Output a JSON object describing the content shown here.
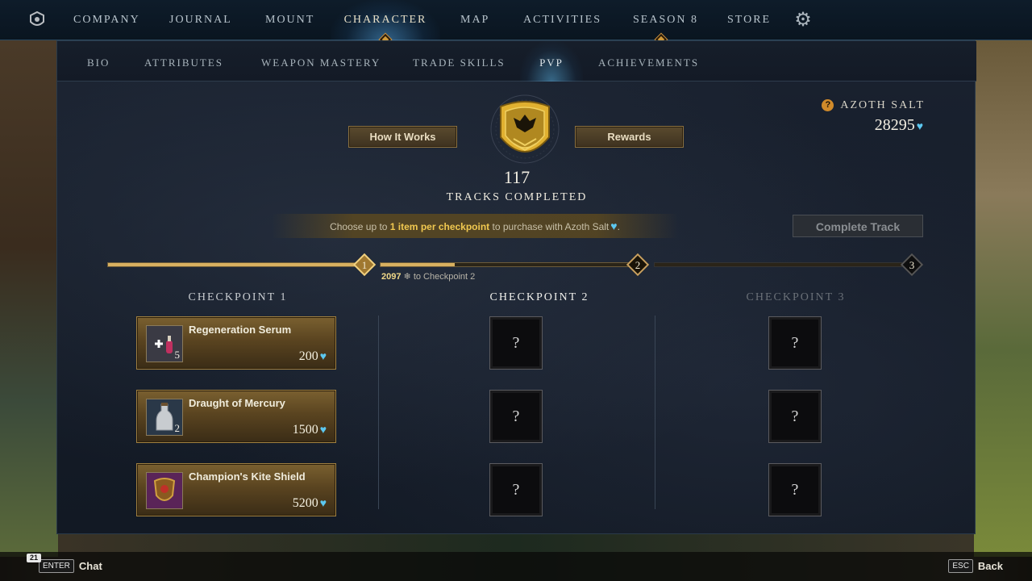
{
  "topnav": {
    "logo_icon": "company-crest-icon",
    "items": [
      {
        "label": "COMPANY",
        "active": false
      },
      {
        "label": "JOURNAL",
        "active": false
      },
      {
        "label": "MOUNT",
        "active": false
      },
      {
        "label": "CHARACTER",
        "active": true
      },
      {
        "label": "MAP",
        "active": false
      },
      {
        "label": "ACTIVITIES",
        "active": false
      },
      {
        "label": "SEASON 8",
        "active": false
      },
      {
        "label": "STORE",
        "active": false
      }
    ],
    "settings_icon": "gear-icon"
  },
  "subnav": {
    "tabs": [
      {
        "label": "BIO",
        "active": false
      },
      {
        "label": "ATTRIBUTES",
        "active": false
      },
      {
        "label": "WEAPON MASTERY",
        "active": false
      },
      {
        "label": "TRADE SKILLS",
        "active": false
      },
      {
        "label": "PVP",
        "active": true
      },
      {
        "label": "ACHIEVEMENTS",
        "active": false
      }
    ]
  },
  "pvp": {
    "how_it_works_label": "How It Works",
    "rewards_label": "Rewards",
    "tracks_completed_value": "117",
    "tracks_completed_label": "TRACKS COMPLETED",
    "currency": {
      "label": "AZOTH SALT",
      "value": "28295",
      "help_glyph": "?"
    },
    "info": {
      "prefix": "Choose up to ",
      "highlight": "1 item per checkpoint",
      "suffix": " to purchase with Azoth Salt"
    },
    "complete_track_label": "Complete Track",
    "progress": {
      "checkpoint_1_fill": 1.0,
      "checkpoint_2_fill": 0.3,
      "checkpoint_3_fill": 0.0,
      "remaining_value": "2097",
      "remaining_suffix": " to Checkpoint 2",
      "node_labels": [
        "1",
        "2",
        "3"
      ]
    },
    "checkpoints": [
      {
        "title": "CHECKPOINT 1",
        "state": "active"
      },
      {
        "title": "CHECKPOINT 2",
        "state": "current"
      },
      {
        "title": "CHECKPOINT 3",
        "state": "locked"
      }
    ],
    "checkpoint1_items": [
      {
        "name": "Regeneration Serum",
        "qty": "5",
        "price": "200",
        "icon": "regeneration-serum-icon"
      },
      {
        "name": "Draught of Mercury",
        "qty": "2",
        "price": "1500",
        "icon": "potion-bottle-icon"
      },
      {
        "name": "Champion's Kite Shield",
        "qty": "",
        "price": "5200",
        "icon": "kite-shield-icon"
      }
    ],
    "locked_glyph": "?"
  },
  "bottombar": {
    "badge_count": "21",
    "chat_key": "ENTER",
    "chat_label": "Chat",
    "back_key": "ESC",
    "back_label": "Back"
  },
  "colors": {
    "accent_gold": "#d8b060",
    "salt_blue": "#5cc8f0",
    "nav_bg": "#0e1c2a"
  }
}
